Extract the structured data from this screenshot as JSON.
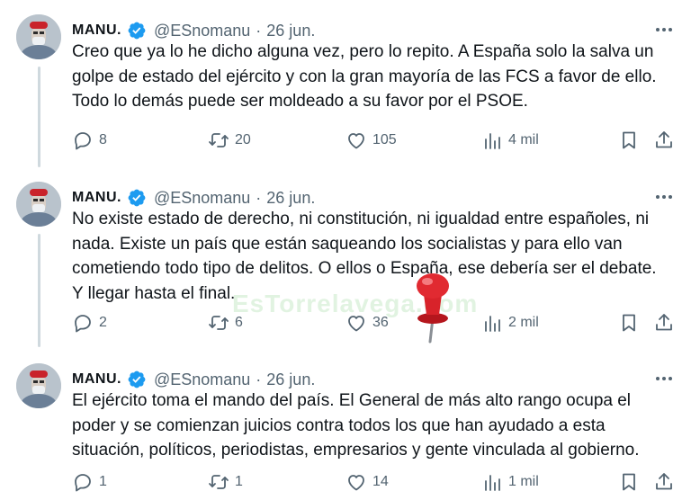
{
  "watermark_text": "EsTorrelavega.com",
  "tweets": [
    {
      "name": "MANU.",
      "handle": "@ESnomanu",
      "separator": "·",
      "date": "26 jun.",
      "lines": [
        "Creo que ya lo he dicho alguna vez, pero lo repito. A España solo la salva un",
        "golpe de estado del ejército y con la gran mayoría de las FCS a favor de ello.",
        "Todo lo demás puede ser moldeado a su favor por el PSOE."
      ],
      "stats": {
        "replies": "8",
        "retweets": "20",
        "likes": "105",
        "views": "4 mil"
      }
    },
    {
      "name": "MANU.",
      "handle": "@ESnomanu",
      "separator": "·",
      "date": "26 jun.",
      "lines": [
        "No existe estado de derecho, ni constitución, ni igualdad entre españoles, ni",
        "nada. Existe un país que están saqueando los socialistas y para ello van",
        "cometiendo todo tipo de delitos. O ellos o España, ese debería ser el debate.",
        "Y llegar hasta el final."
      ],
      "stats": {
        "replies": "2",
        "retweets": "6",
        "likes": "36",
        "views": "2 mil"
      }
    },
    {
      "name": "MANU.",
      "handle": "@ESnomanu",
      "separator": "·",
      "date": "26 jun.",
      "lines": [
        "El ejército toma el mando del país. El General de más alto rango ocupa el",
        "poder y se comienzan juicios contra todos los que han ayudado a esta",
        "situación, políticos, periodistas, empresarios y gente vinculada al gobierno."
      ],
      "stats": {
        "replies": "1",
        "retweets": "1",
        "likes": "14",
        "views": "1 mil"
      }
    }
  ],
  "icons": {
    "verified": "verified-badge-icon",
    "more": "more-horizontal-icon",
    "reply": "reply-icon",
    "retweet": "retweet-icon",
    "like": "heart-icon",
    "views": "views-chart-icon",
    "bookmark": "bookmark-icon",
    "share": "share-icon"
  },
  "colors": {
    "verified": "#1d9bf0",
    "muted": "#536471",
    "text": "#0f1419",
    "pin": "#d8232a"
  }
}
